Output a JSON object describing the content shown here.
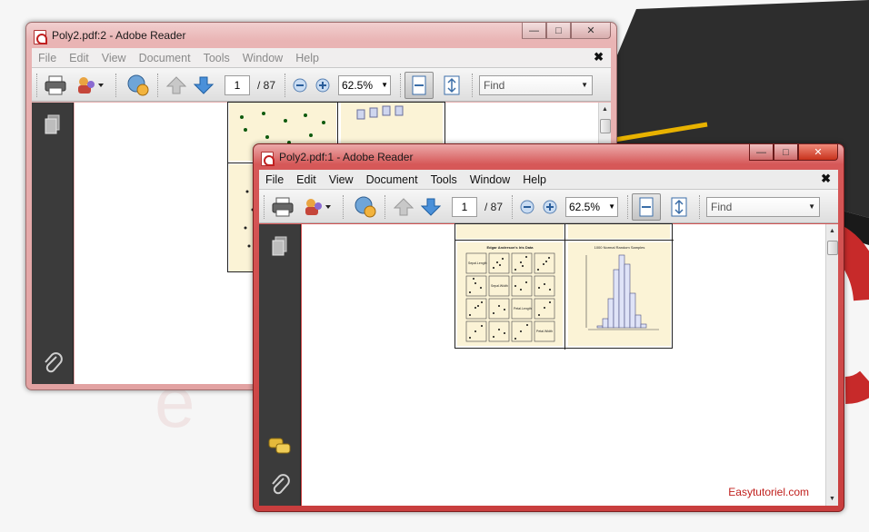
{
  "watermark": "Easytutoriel.com",
  "windows": {
    "back": {
      "title": "Poly2.pdf:2 - Adobe Reader",
      "menu": [
        "File",
        "Edit",
        "View",
        "Document",
        "Tools",
        "Window",
        "Help"
      ],
      "page_current": "1",
      "page_total": "/ 87",
      "zoom": "62.5%",
      "find_placeholder": "Find"
    },
    "front": {
      "title": "Poly2.pdf:1 - Adobe Reader",
      "menu": [
        "File",
        "Edit",
        "View",
        "Document",
        "Tools",
        "Window",
        "Help"
      ],
      "page_current": "1",
      "page_total": "/ 87",
      "zoom": "62.5%",
      "find_placeholder": "Find",
      "page_panels": {
        "left_title": "Edgar Anderson's Iris Data",
        "left_labels": [
          "Sepal.Length",
          "Sepal.Width",
          "Petal.Length",
          "Petal.Width"
        ],
        "right_title": "1000 Normal Random Samples"
      }
    }
  },
  "icons": {
    "title": "pdf-icon",
    "print": "printer-icon",
    "collab": "collaborate-icon",
    "share": "share-icon",
    "prev": "arrow-up-icon",
    "next": "arrow-down-icon",
    "zoom_out": "zoom-out-icon",
    "zoom_in": "zoom-in-icon",
    "fit_width": "fit-width-icon",
    "fit_page": "fit-page-icon",
    "pages": "pages-icon",
    "attach": "paperclip-icon",
    "comments": "comments-icon"
  },
  "colors": {
    "accent_red": "#c93e3e",
    "watermark": "#c0201d",
    "panel_bg": "#fbf3d6",
    "nav_pane": "#3b3b3b"
  }
}
